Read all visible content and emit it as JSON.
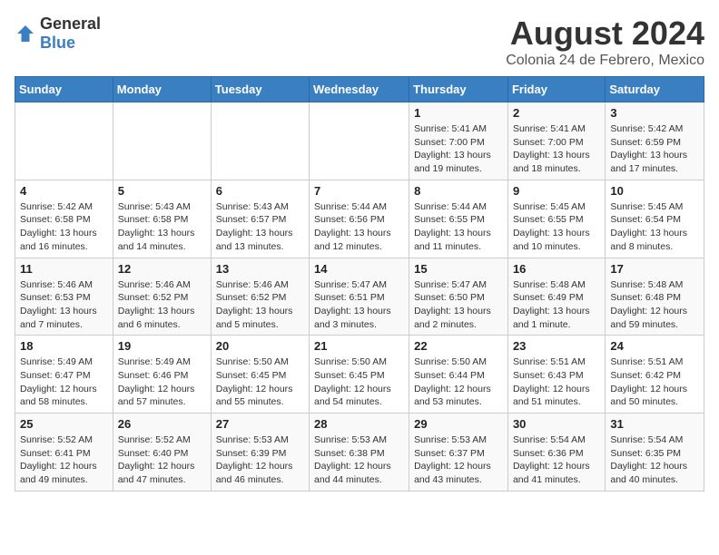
{
  "logo": {
    "general": "General",
    "blue": "Blue"
  },
  "title": "August 2024",
  "subtitle": "Colonia 24 de Febrero, Mexico",
  "days_of_week": [
    "Sunday",
    "Monday",
    "Tuesday",
    "Wednesday",
    "Thursday",
    "Friday",
    "Saturday"
  ],
  "weeks": [
    [
      {
        "day": "",
        "info": ""
      },
      {
        "day": "",
        "info": ""
      },
      {
        "day": "",
        "info": ""
      },
      {
        "day": "",
        "info": ""
      },
      {
        "day": "1",
        "info": "Sunrise: 5:41 AM\nSunset: 7:00 PM\nDaylight: 13 hours\nand 19 minutes."
      },
      {
        "day": "2",
        "info": "Sunrise: 5:41 AM\nSunset: 7:00 PM\nDaylight: 13 hours\nand 18 minutes."
      },
      {
        "day": "3",
        "info": "Sunrise: 5:42 AM\nSunset: 6:59 PM\nDaylight: 13 hours\nand 17 minutes."
      }
    ],
    [
      {
        "day": "4",
        "info": "Sunrise: 5:42 AM\nSunset: 6:58 PM\nDaylight: 13 hours\nand 16 minutes."
      },
      {
        "day": "5",
        "info": "Sunrise: 5:43 AM\nSunset: 6:58 PM\nDaylight: 13 hours\nand 14 minutes."
      },
      {
        "day": "6",
        "info": "Sunrise: 5:43 AM\nSunset: 6:57 PM\nDaylight: 13 hours\nand 13 minutes."
      },
      {
        "day": "7",
        "info": "Sunrise: 5:44 AM\nSunset: 6:56 PM\nDaylight: 13 hours\nand 12 minutes."
      },
      {
        "day": "8",
        "info": "Sunrise: 5:44 AM\nSunset: 6:55 PM\nDaylight: 13 hours\nand 11 minutes."
      },
      {
        "day": "9",
        "info": "Sunrise: 5:45 AM\nSunset: 6:55 PM\nDaylight: 13 hours\nand 10 minutes."
      },
      {
        "day": "10",
        "info": "Sunrise: 5:45 AM\nSunset: 6:54 PM\nDaylight: 13 hours\nand 8 minutes."
      }
    ],
    [
      {
        "day": "11",
        "info": "Sunrise: 5:46 AM\nSunset: 6:53 PM\nDaylight: 13 hours\nand 7 minutes."
      },
      {
        "day": "12",
        "info": "Sunrise: 5:46 AM\nSunset: 6:52 PM\nDaylight: 13 hours\nand 6 minutes."
      },
      {
        "day": "13",
        "info": "Sunrise: 5:46 AM\nSunset: 6:52 PM\nDaylight: 13 hours\nand 5 minutes."
      },
      {
        "day": "14",
        "info": "Sunrise: 5:47 AM\nSunset: 6:51 PM\nDaylight: 13 hours\nand 3 minutes."
      },
      {
        "day": "15",
        "info": "Sunrise: 5:47 AM\nSunset: 6:50 PM\nDaylight: 13 hours\nand 2 minutes."
      },
      {
        "day": "16",
        "info": "Sunrise: 5:48 AM\nSunset: 6:49 PM\nDaylight: 13 hours\nand 1 minute."
      },
      {
        "day": "17",
        "info": "Sunrise: 5:48 AM\nSunset: 6:48 PM\nDaylight: 12 hours\nand 59 minutes."
      }
    ],
    [
      {
        "day": "18",
        "info": "Sunrise: 5:49 AM\nSunset: 6:47 PM\nDaylight: 12 hours\nand 58 minutes."
      },
      {
        "day": "19",
        "info": "Sunrise: 5:49 AM\nSunset: 6:46 PM\nDaylight: 12 hours\nand 57 minutes."
      },
      {
        "day": "20",
        "info": "Sunrise: 5:50 AM\nSunset: 6:45 PM\nDaylight: 12 hours\nand 55 minutes."
      },
      {
        "day": "21",
        "info": "Sunrise: 5:50 AM\nSunset: 6:45 PM\nDaylight: 12 hours\nand 54 minutes."
      },
      {
        "day": "22",
        "info": "Sunrise: 5:50 AM\nSunset: 6:44 PM\nDaylight: 12 hours\nand 53 minutes."
      },
      {
        "day": "23",
        "info": "Sunrise: 5:51 AM\nSunset: 6:43 PM\nDaylight: 12 hours\nand 51 minutes."
      },
      {
        "day": "24",
        "info": "Sunrise: 5:51 AM\nSunset: 6:42 PM\nDaylight: 12 hours\nand 50 minutes."
      }
    ],
    [
      {
        "day": "25",
        "info": "Sunrise: 5:52 AM\nSunset: 6:41 PM\nDaylight: 12 hours\nand 49 minutes."
      },
      {
        "day": "26",
        "info": "Sunrise: 5:52 AM\nSunset: 6:40 PM\nDaylight: 12 hours\nand 47 minutes."
      },
      {
        "day": "27",
        "info": "Sunrise: 5:53 AM\nSunset: 6:39 PM\nDaylight: 12 hours\nand 46 minutes."
      },
      {
        "day": "28",
        "info": "Sunrise: 5:53 AM\nSunset: 6:38 PM\nDaylight: 12 hours\nand 44 minutes."
      },
      {
        "day": "29",
        "info": "Sunrise: 5:53 AM\nSunset: 6:37 PM\nDaylight: 12 hours\nand 43 minutes."
      },
      {
        "day": "30",
        "info": "Sunrise: 5:54 AM\nSunset: 6:36 PM\nDaylight: 12 hours\nand 41 minutes."
      },
      {
        "day": "31",
        "info": "Sunrise: 5:54 AM\nSunset: 6:35 PM\nDaylight: 12 hours\nand 40 minutes."
      }
    ]
  ]
}
